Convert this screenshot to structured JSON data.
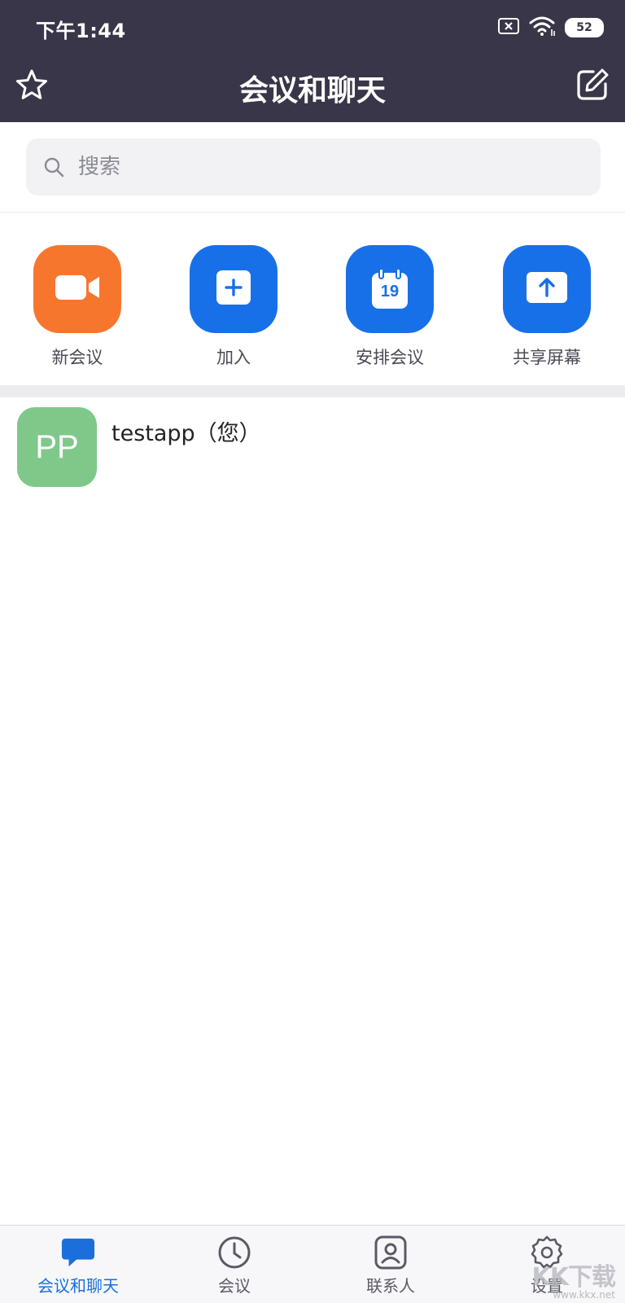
{
  "status_bar": {
    "time": "下午1:44",
    "battery": "52",
    "icons": [
      "sim-off-icon",
      "wifi-icon",
      "battery-icon"
    ]
  },
  "header": {
    "title": "会议和聊天",
    "left_icon": "star-icon",
    "right_icon": "compose-icon"
  },
  "search": {
    "placeholder": "搜索"
  },
  "actions": [
    {
      "label": "新会议",
      "icon": "video-camera-icon",
      "color": "#F7762E"
    },
    {
      "label": "加入",
      "icon": "plus-icon",
      "color": "#1870E8"
    },
    {
      "label": "安排会议",
      "icon": "calendar-icon",
      "color": "#1870E8",
      "calendar_day": "19"
    },
    {
      "label": "共享屏幕",
      "icon": "share-up-icon",
      "color": "#1870E8"
    }
  ],
  "contacts": [
    {
      "initials": "PP",
      "name": "testapp（您）",
      "avatar_color": "#7FC88A"
    }
  ],
  "tabbar": {
    "active_color": "#1B6FDC",
    "items": [
      {
        "label": "会议和聊天",
        "icon": "chat-bubble-icon",
        "active": true
      },
      {
        "label": "会议",
        "icon": "clock-icon",
        "active": false
      },
      {
        "label": "联系人",
        "icon": "contact-icon",
        "active": false
      },
      {
        "label": "设置",
        "icon": "gear-icon",
        "active": false
      }
    ]
  },
  "watermark": {
    "logo": "KK下载",
    "url": "www.kkx.net"
  }
}
